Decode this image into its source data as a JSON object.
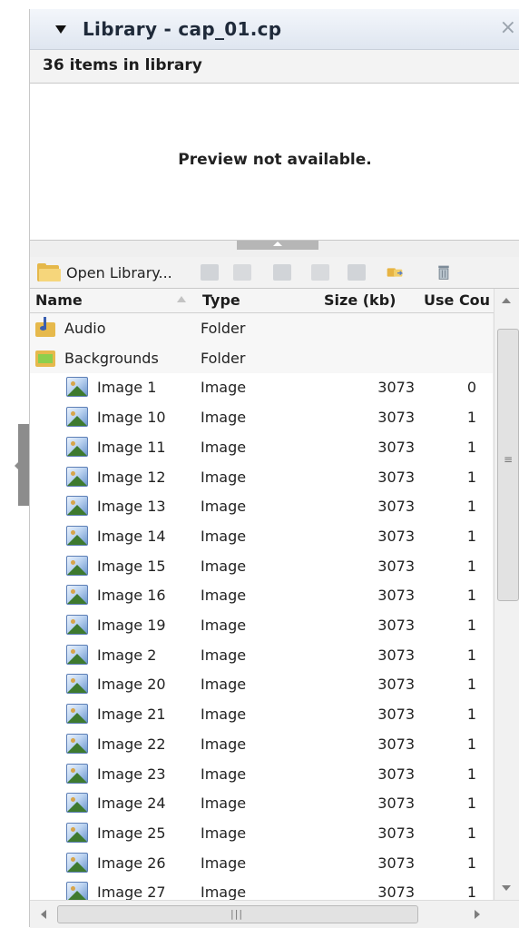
{
  "panel": {
    "title": "Library - cap_01.cp",
    "close_glyph": "×",
    "item_count": "36 items in library",
    "preview_message": "Preview not available."
  },
  "toolbar": {
    "open_library_label": "Open Library...",
    "icons": [
      "open-library-folder-icon",
      "new-folder-icon",
      "properties-icon",
      "usage-icon",
      "update-icon",
      "duplicate-icon",
      "select-unused-icon",
      "delete-icon"
    ]
  },
  "columns": {
    "name": "Name",
    "type": "Type",
    "size": "Size (kb)",
    "use_count": "Use Cou"
  },
  "rows": [
    {
      "name": "Audio",
      "type": "Folder",
      "size": "",
      "use": "",
      "kind": "audio-folder"
    },
    {
      "name": "Backgrounds",
      "type": "Folder",
      "size": "",
      "use": "",
      "kind": "bg-folder"
    },
    {
      "name": "Image 1",
      "type": "Image",
      "size": "3073",
      "use": "0",
      "kind": "image"
    },
    {
      "name": "Image 10",
      "type": "Image",
      "size": "3073",
      "use": "1",
      "kind": "image"
    },
    {
      "name": "Image 11",
      "type": "Image",
      "size": "3073",
      "use": "1",
      "kind": "image"
    },
    {
      "name": "Image 12",
      "type": "Image",
      "size": "3073",
      "use": "1",
      "kind": "image"
    },
    {
      "name": "Image 13",
      "type": "Image",
      "size": "3073",
      "use": "1",
      "kind": "image"
    },
    {
      "name": "Image 14",
      "type": "Image",
      "size": "3073",
      "use": "1",
      "kind": "image"
    },
    {
      "name": "Image 15",
      "type": "Image",
      "size": "3073",
      "use": "1",
      "kind": "image"
    },
    {
      "name": "Image 16",
      "type": "Image",
      "size": "3073",
      "use": "1",
      "kind": "image"
    },
    {
      "name": "Image 19",
      "type": "Image",
      "size": "3073",
      "use": "1",
      "kind": "image"
    },
    {
      "name": "Image 2",
      "type": "Image",
      "size": "3073",
      "use": "1",
      "kind": "image"
    },
    {
      "name": "Image 20",
      "type": "Image",
      "size": "3073",
      "use": "1",
      "kind": "image"
    },
    {
      "name": "Image 21",
      "type": "Image",
      "size": "3073",
      "use": "1",
      "kind": "image"
    },
    {
      "name": "Image 22",
      "type": "Image",
      "size": "3073",
      "use": "1",
      "kind": "image"
    },
    {
      "name": "Image 23",
      "type": "Image",
      "size": "3073",
      "use": "1",
      "kind": "image"
    },
    {
      "name": "Image 24",
      "type": "Image",
      "size": "3073",
      "use": "1",
      "kind": "image"
    },
    {
      "name": "Image 25",
      "type": "Image",
      "size": "3073",
      "use": "1",
      "kind": "image"
    },
    {
      "name": "Image 26",
      "type": "Image",
      "size": "3073",
      "use": "1",
      "kind": "image"
    },
    {
      "name": "Image 27",
      "type": "Image",
      "size": "3073",
      "use": "1",
      "kind": "image"
    }
  ],
  "colors": {
    "folder_yellow": "#e5b84a",
    "title_gradient_top": "#f3f6fb",
    "title_gradient_bottom": "#dfe6f0"
  }
}
